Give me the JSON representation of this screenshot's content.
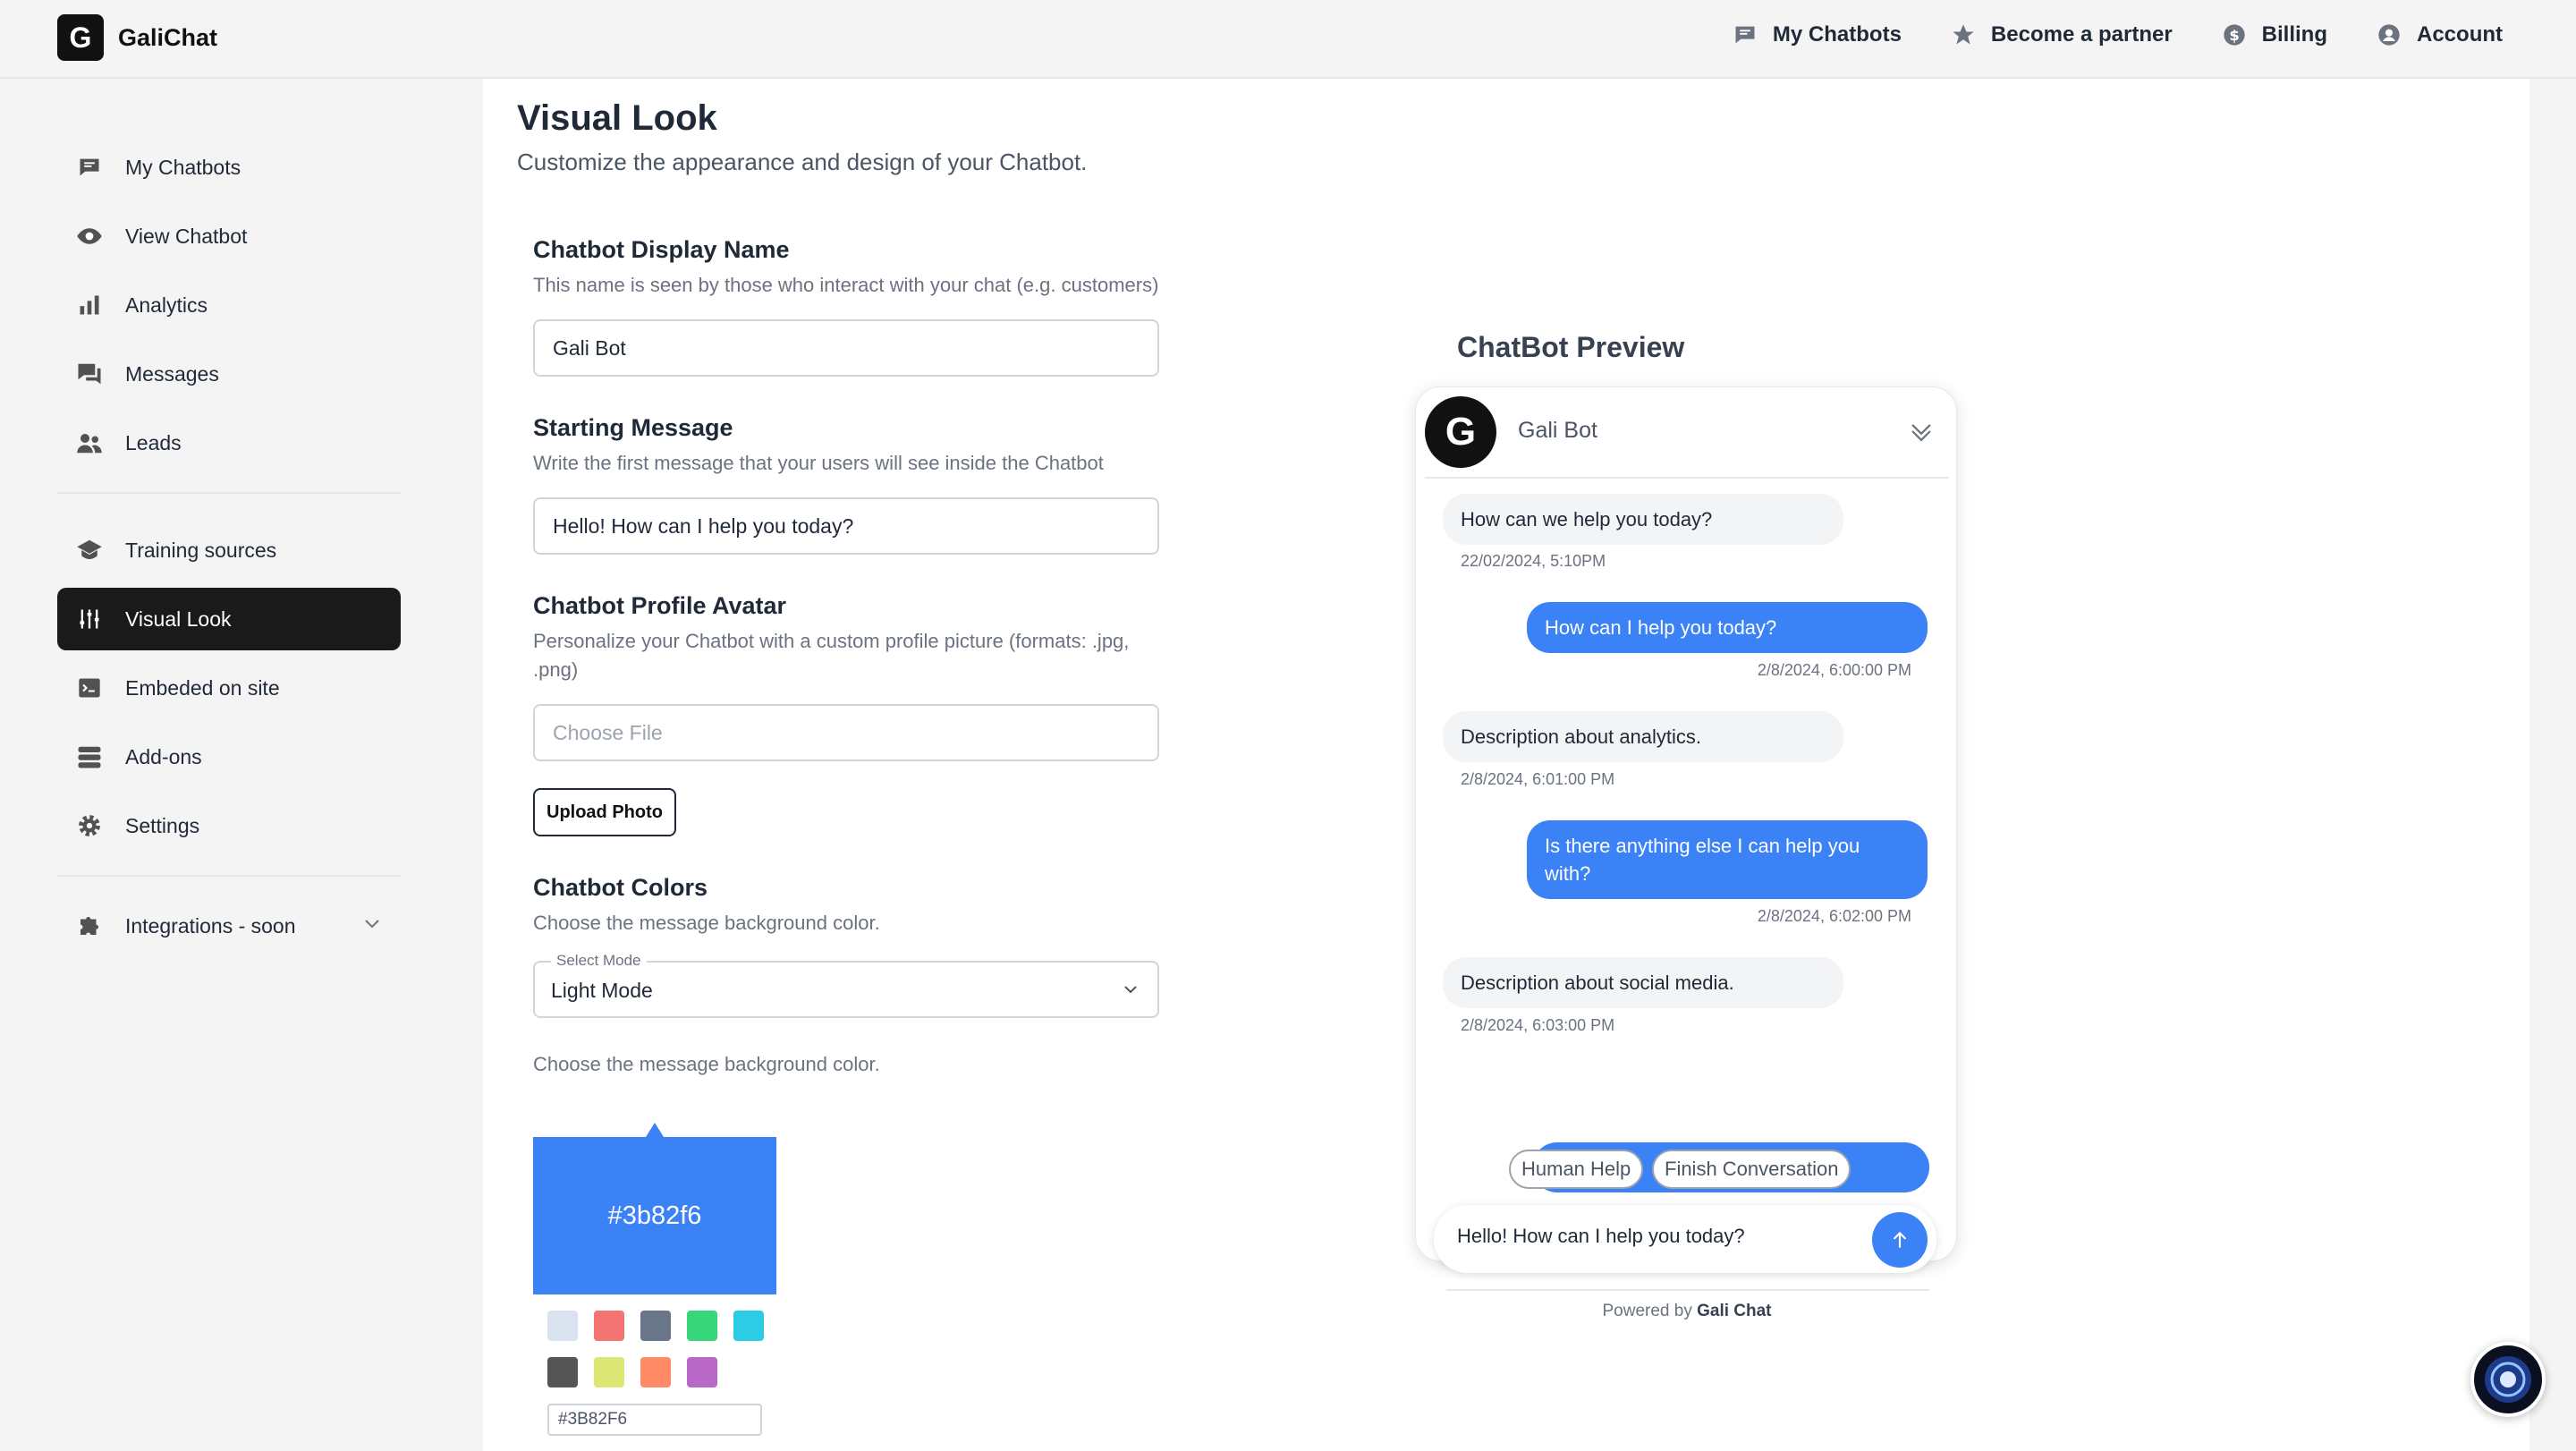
{
  "brand": {
    "logo_letter": "G",
    "name": "GaliChat"
  },
  "topnav": [
    {
      "label": "My Chatbots",
      "icon": "chat-bubble-icon"
    },
    {
      "label": "Become a partner",
      "icon": "star-icon"
    },
    {
      "label": "Billing",
      "icon": "dollar-icon"
    },
    {
      "label": "Account",
      "icon": "user-circle-icon"
    }
  ],
  "sidebar": {
    "group1": [
      {
        "label": "My Chatbots",
        "icon": "chat-bubble-icon"
      },
      {
        "label": "View Chatbot",
        "icon": "eye-icon"
      },
      {
        "label": "Analytics",
        "icon": "bar-chart-icon"
      },
      {
        "label": "Messages",
        "icon": "messages-icon"
      },
      {
        "label": "Leads",
        "icon": "users-icon"
      }
    ],
    "group2": [
      {
        "label": "Training sources",
        "icon": "graduation-cap-icon"
      },
      {
        "label": "Visual Look",
        "icon": "sliders-icon",
        "active": true
      },
      {
        "label": "Embeded on site",
        "icon": "terminal-icon"
      },
      {
        "label": "Add-ons",
        "icon": "layers-icon"
      },
      {
        "label": "Settings",
        "icon": "gear-icon"
      }
    ],
    "group3": [
      {
        "label": "Integrations - soon",
        "icon": "puzzle-icon"
      }
    ]
  },
  "page": {
    "title": "Visual Look",
    "subtitle": "Customize the appearance and design of your Chatbot."
  },
  "form": {
    "display_name": {
      "label": "Chatbot Display Name",
      "desc": "This name is seen by those who interact with your chat (e.g. customers)",
      "value": "Gali Bot"
    },
    "starting_message": {
      "label": "Starting Message",
      "desc": "Write the first message that your users will see inside the Chatbot",
      "value": "Hello! How can I help you today?"
    },
    "avatar": {
      "label": "Chatbot Profile Avatar",
      "desc": "Personalize your Chatbot with a custom profile picture (formats: .jpg, .png)",
      "placeholder": "Choose File",
      "upload_label": "Upload Photo"
    },
    "colors": {
      "label": "Chatbot Colors",
      "desc": "Choose the message background color.",
      "select_legend": "Select Mode",
      "select_value": "Light Mode",
      "desc2": "Choose the message background color.",
      "current_color": "#3b82f6",
      "current_label": "#3b82f6",
      "hex_input": "#3B82F6",
      "swatches": [
        "#d9e3f0",
        "#f47373",
        "#697689",
        "#37d67a",
        "#2ccce4",
        "#555555",
        "#dce775",
        "#ff8a65",
        "#ba68c8"
      ]
    }
  },
  "preview": {
    "title": "ChatBot Preview",
    "avatar_letter": "G",
    "bot_name": "Gali Bot",
    "messages": [
      {
        "from": "bot",
        "text": "How can we help you today?",
        "time": "22/02/2024, 5:10PM"
      },
      {
        "from": "user",
        "text": "How can I help you today?",
        "time": "2/8/2024, 6:00:00 PM"
      },
      {
        "from": "bot",
        "text": "Description about analytics.",
        "time": "2/8/2024, 6:01:00 PM"
      },
      {
        "from": "user",
        "text": "Is there anything else I can help you with?",
        "time": "2/8/2024, 6:02:00 PM"
      },
      {
        "from": "bot",
        "text": "Description about social media.",
        "time": "2/8/2024, 6:03:00 PM"
      }
    ],
    "quick_replies": [
      "Human Help",
      "Finish Conversation"
    ],
    "input_value": "Hello! How can I help you today?",
    "powered_prefix": "Powered by",
    "powered_brand": "Gali Chat"
  }
}
